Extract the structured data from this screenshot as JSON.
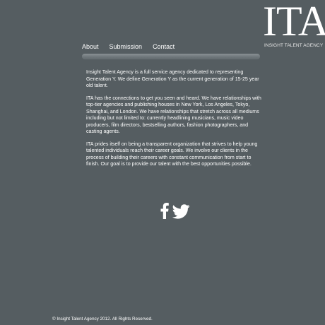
{
  "logo": {
    "mark": "ITA",
    "tagline": "INSIGHT TALENT AGENCY"
  },
  "nav": {
    "items": [
      {
        "label": "About"
      },
      {
        "label": "Submission"
      },
      {
        "label": "Contact"
      }
    ]
  },
  "main": {
    "paragraphs": [
      "Insight Talent Agency is a full service agency dedicated to representing Generation Y. We define Generation Y as the current generation of 15-25 year old talent.",
      "ITA has the connections to get you seen and heard. We have relationships with top-tier agencies and publishing houses in New York, Los Angeles, Tokyo, Shanghai, and London. We have relationships that stretch across all mediums including but not limited to: currently headlining musicians, music video producers, film directors, bestselling authors, fashion photographers, and casting agents.",
      "ITA prides itself on being a transparent organization that strives to help young talented individuals reach their career goals. We involve our clients in the process of building their careers with constant communication from start to finish. Our goal is to provide our talent with the best opportunities possible."
    ]
  },
  "social": {
    "icons": [
      "facebook-icon",
      "twitter-icon"
    ]
  },
  "footer": {
    "copyright": "© Insight Talent Agency 2012. All Rights Reserved."
  },
  "colors": {
    "background": "#555d61",
    "text": "#ffffff",
    "nav_bar": "#6f777b"
  }
}
